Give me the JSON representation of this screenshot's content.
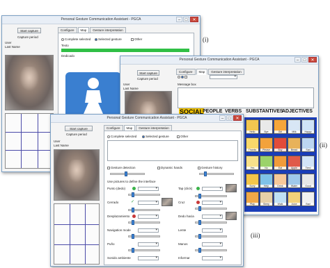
{
  "app": {
    "window_title": "Personal Gesture Communication Assistant - PGCA",
    "capture_button": "Capture period",
    "start_button": "Start capture",
    "user_label": "User",
    "user_value": "Last Name"
  },
  "tabs": [
    "Configure",
    "Map",
    "Gesture interpretation"
  ],
  "window_i": {
    "callout": "(i)",
    "options": [
      "Complete selected",
      "Selected gesture",
      "Other"
    ],
    "output_label": "Texto",
    "output_line": "Dedicado"
  },
  "window_ii": {
    "callout": "(ii)",
    "output_label": "Message box",
    "categories": [
      "SOCIAL",
      "PEOPLE",
      "VERBS",
      "SUBSTANTIVES",
      "ADJECTIVES"
    ],
    "pictograms": [
      [
        "Hello",
        "Bye",
        "Girl",
        "Milk",
        "Happy"
      ],
      [
        "Thanks",
        "Please",
        "Boy",
        "Bread",
        "Sad"
      ],
      [
        "Yes",
        "No",
        "Eat",
        "Apple",
        "Tired"
      ],
      [
        "Sorry",
        "Help",
        "Drink",
        "Water",
        "Good"
      ],
      [
        "Play",
        "Sleep",
        "Walk",
        "Juice",
        "Bad"
      ]
    ],
    "mini_button": "Start capture"
  },
  "window_iii": {
    "callout": "(iii)",
    "options": [
      "Complete selected",
      "Selected gesture",
      "Other"
    ],
    "checks": [
      "Gesture detection",
      "Dynamic hands",
      "Gesture history"
    ],
    "section_label": "Use pictures to define the interface",
    "left_rows": [
      "Punto (dedo)",
      "Cerrado",
      "Desplazamiento",
      "Navigation mode",
      "Puño",
      "Sonido ambiente"
    ],
    "right_rows": [
      "Tap (click)",
      "Cruz",
      "Dedo hacia",
      "Lente",
      "Manos",
      "Informar"
    ]
  },
  "colors": {
    "window_border": "#7a9fc4",
    "accent_blue": "#3c84d8",
    "green_bar": "#2fbf45",
    "icon_tile": "#3a7fd0",
    "social_highlight": "#f4c400",
    "board_background": "#1a3db8"
  },
  "icons": {
    "restroom": "woman-restroom-icon"
  }
}
